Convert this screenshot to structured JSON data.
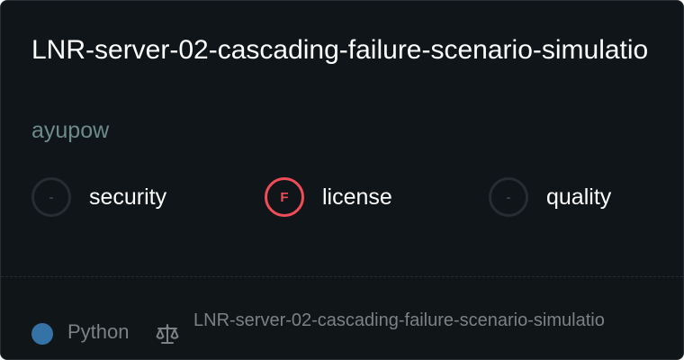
{
  "repo": {
    "title": "LNR-server-02-cascading-failure-scenario-simulatio",
    "owner": "ayupow"
  },
  "scores": [
    {
      "label": "security",
      "grade": "-",
      "status": "none"
    },
    {
      "label": "license",
      "grade": "F",
      "status": "fail"
    },
    {
      "label": "quality",
      "grade": "-",
      "status": "none"
    }
  ],
  "footer": {
    "language": "Python",
    "language_color": "#3572a5",
    "license_icon": "scale-icon",
    "license_text": "LNR-server-02-cascading-failure-scenario-simulatio"
  },
  "colors": {
    "background": "#0f1518",
    "fail": "#f14d58",
    "owner": "#6c8b8a"
  }
}
